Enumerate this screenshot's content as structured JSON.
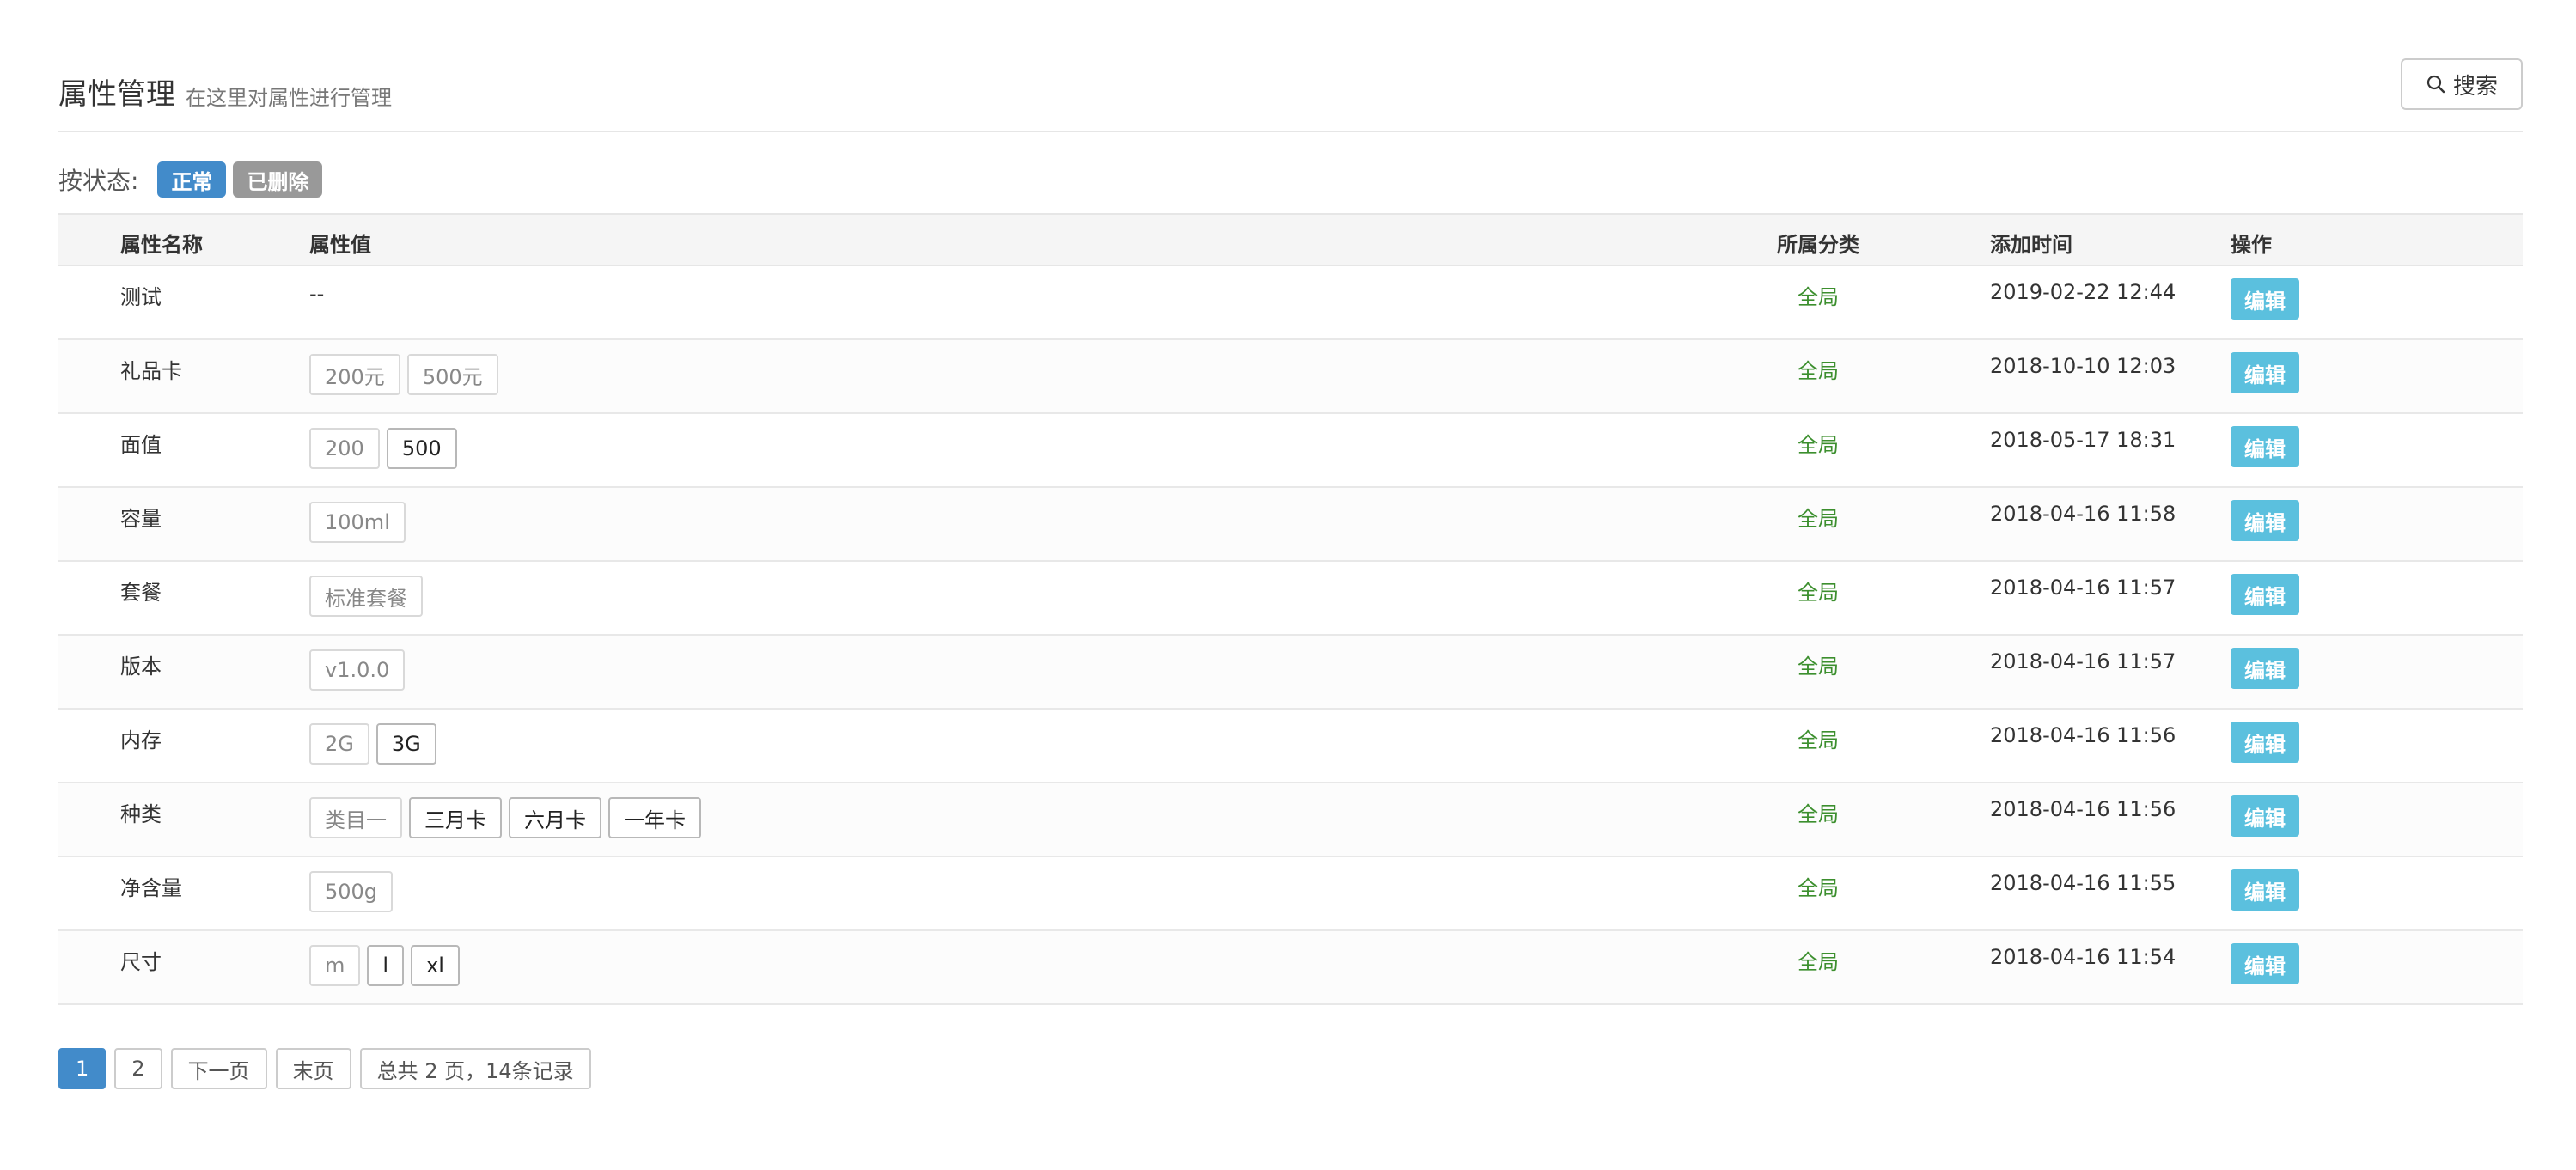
{
  "header": {
    "title": "属性管理",
    "subtitle": "在这里对属性进行管理",
    "search_label": "搜索"
  },
  "filter": {
    "label": "按状态:",
    "badges": [
      "正常",
      "已删除"
    ]
  },
  "table": {
    "columns": [
      "属性名称",
      "属性值",
      "所属分类",
      "添加时间",
      "操作"
    ],
    "rows": [
      {
        "name": "测试",
        "values": [],
        "empty": "--",
        "category": "全局",
        "time": "2019-02-22 12:44",
        "action": "编辑"
      },
      {
        "name": "礼品卡",
        "values": [
          {
            "text": "200元",
            "dark": false
          },
          {
            "text": "500元",
            "dark": false
          }
        ],
        "category": "全局",
        "time": "2018-10-10 12:03",
        "action": "编辑"
      },
      {
        "name": "面值",
        "values": [
          {
            "text": "200",
            "dark": false
          },
          {
            "text": "500",
            "dark": true
          }
        ],
        "category": "全局",
        "time": "2018-05-17 18:31",
        "action": "编辑"
      },
      {
        "name": "容量",
        "values": [
          {
            "text": "100ml",
            "dark": false
          }
        ],
        "category": "全局",
        "time": "2018-04-16 11:58",
        "action": "编辑"
      },
      {
        "name": "套餐",
        "values": [
          {
            "text": "标准套餐",
            "dark": false
          }
        ],
        "category": "全局",
        "time": "2018-04-16 11:57",
        "action": "编辑"
      },
      {
        "name": "版本",
        "values": [
          {
            "text": "v1.0.0",
            "dark": false
          }
        ],
        "category": "全局",
        "time": "2018-04-16 11:57",
        "action": "编辑"
      },
      {
        "name": "内存",
        "values": [
          {
            "text": "2G",
            "dark": false
          },
          {
            "text": "3G",
            "dark": true
          }
        ],
        "category": "全局",
        "time": "2018-04-16 11:56",
        "action": "编辑"
      },
      {
        "name": "种类",
        "values": [
          {
            "text": "类目一",
            "dark": false
          },
          {
            "text": "三月卡",
            "dark": true
          },
          {
            "text": "六月卡",
            "dark": true
          },
          {
            "text": "一年卡",
            "dark": true
          }
        ],
        "category": "全局",
        "time": "2018-04-16 11:56",
        "action": "编辑"
      },
      {
        "name": "净含量",
        "values": [
          {
            "text": "500g",
            "dark": false
          }
        ],
        "category": "全局",
        "time": "2018-04-16 11:55",
        "action": "编辑"
      },
      {
        "name": "尺寸",
        "values": [
          {
            "text": "m",
            "dark": false
          },
          {
            "text": "l",
            "dark": true
          },
          {
            "text": "xl",
            "dark": true
          }
        ],
        "category": "全局",
        "time": "2018-04-16 11:54",
        "action": "编辑"
      }
    ]
  },
  "pagination": {
    "pages": [
      "1",
      "2"
    ],
    "current": "1",
    "next_label": "下一页",
    "last_label": "末页",
    "info": "总共 2 页，14条记录"
  },
  "colors": {
    "primary": "#428bca",
    "edit": "#5bc0de",
    "category": "#3c8f2e",
    "deleted": "#999999"
  },
  "icons": {
    "search": "search-icon"
  }
}
